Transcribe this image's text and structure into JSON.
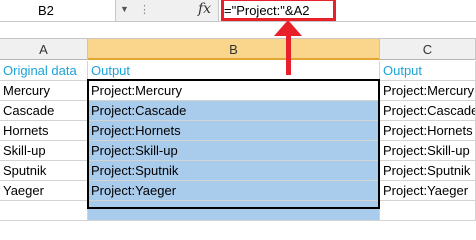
{
  "formula_bar": {
    "name_box": "B2",
    "fx_label": "fx",
    "formula": "=\"Project:\"&A2"
  },
  "columns": [
    {
      "label": "A"
    },
    {
      "label": "B"
    },
    {
      "label": "C"
    }
  ],
  "rows": [
    {
      "a": "Original data",
      "b": "Output",
      "c": "Output"
    },
    {
      "a": "Mercury",
      "b": "Project:Mercury",
      "c": "Project:Mercury"
    },
    {
      "a": "Cascade",
      "b": "Project:Cascade",
      "c": "Project:Cascade"
    },
    {
      "a": "Hornets",
      "b": "Project:Hornets",
      "c": "Project:Hornets"
    },
    {
      "a": "Skill-up",
      "b": "Project:Skill-up",
      "c": "Project:Skill-up"
    },
    {
      "a": "Sputnik",
      "b": "Project:Sputnik",
      "c": "Project:Sputnik"
    },
    {
      "a": "Yaeger",
      "b": "Project:Yaeger",
      "c": "Project:Yaeger"
    }
  ],
  "colors": {
    "annotation": "#e8202a",
    "header_text": "#1ca3d8",
    "selection_fill": "#a9cbec"
  }
}
